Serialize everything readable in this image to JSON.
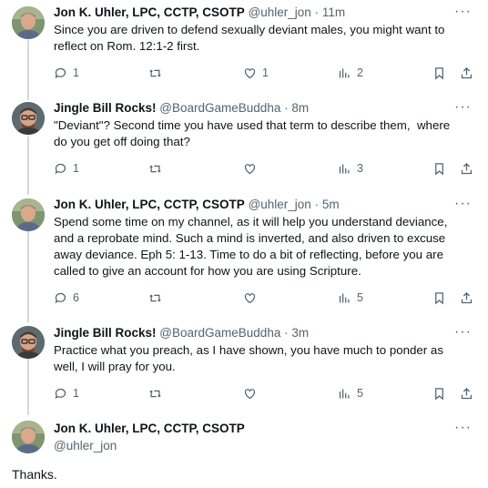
{
  "tweets": [
    {
      "author": "Jon K. Uhler, LPC, CCTP, CSOTP",
      "handle": "@uhler_jon",
      "time": "· 11m",
      "text": "Since you are driven to defend sexually deviant males, you might want to\nreflect on Rom. 12:1-2 first.",
      "replies": "1",
      "retweets": "",
      "likes": "1",
      "views": "2"
    },
    {
      "author": "Jingle Bill Rocks!",
      "handle": "@BoardGameBuddha",
      "time": "· 8m",
      "text": "\"Deviant\"? Second time you have used that term to describe them,  where\ndo you get off doing that?",
      "replies": "1",
      "retweets": "",
      "likes": "",
      "views": "3"
    },
    {
      "author": "Jon K. Uhler, LPC, CCTP, CSOTP",
      "handle": "@uhler_jon",
      "time": "· 5m",
      "text": "Spend some time on my channel, as it will help you understand deviance,\nand a reprobate mind. Such a mind is inverted, and also driven to excuse\naway deviance. Eph 5: 1-13. Time to do a bit of reflecting, before you are\ncalled to give an account for how you are using Scripture.",
      "replies": "6",
      "retweets": "",
      "likes": "",
      "views": "5"
    },
    {
      "author": "Jingle Bill Rocks!",
      "handle": "@BoardGameBuddha",
      "time": "· 3m",
      "text": "Practice what you preach, as I have shown, you have much to ponder as\nwell, I will pray for you.",
      "replies": "1",
      "retweets": "",
      "likes": "",
      "views": "5"
    }
  ],
  "focused": {
    "author": "Jon K. Uhler, LPC, CCTP, CSOTP",
    "handle": "@uhler_jon",
    "text": "Thanks."
  },
  "more_label": "···",
  "icons": {
    "reply": "reply-icon",
    "retweet": "retweet-icon",
    "like": "like-icon",
    "views": "views-icon",
    "bookmark": "bookmark-icon",
    "share": "share-icon"
  },
  "colors": {
    "text": "#0f1419",
    "secondary": "#536471",
    "thread_line": "#cfd9de"
  }
}
